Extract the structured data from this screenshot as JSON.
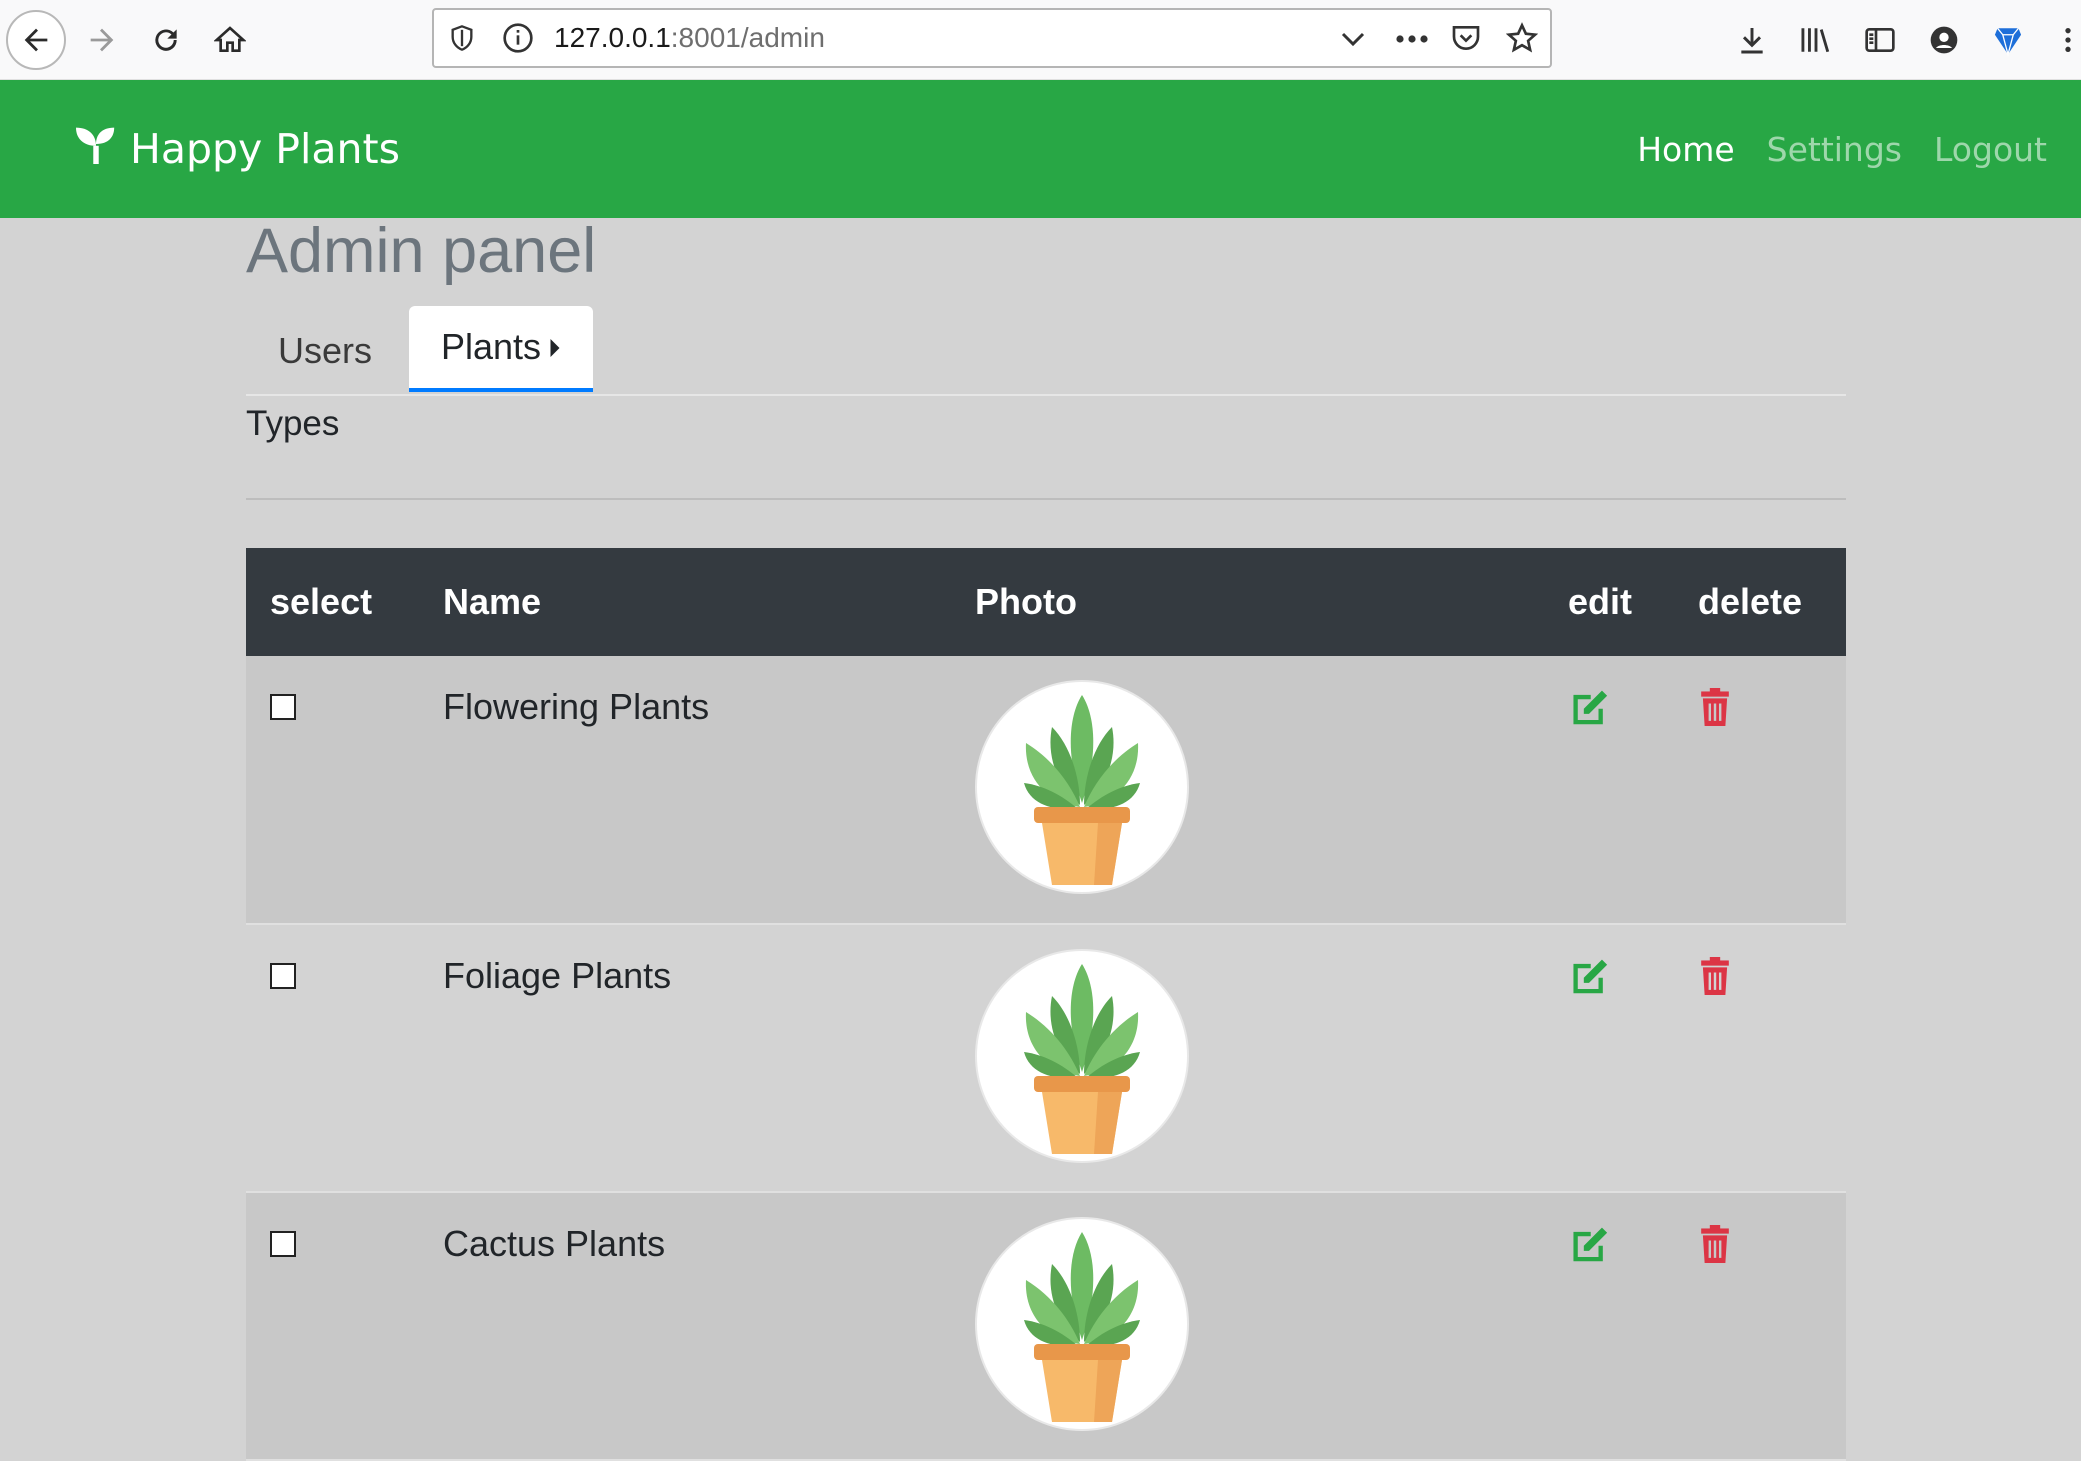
{
  "browser": {
    "url_host": "127.0.0.1",
    "url_rest": ":8001/admin"
  },
  "navbar": {
    "brand": "Happy Plants",
    "links": [
      {
        "label": "Home",
        "active": true
      },
      {
        "label": "Settings",
        "active": false
      },
      {
        "label": "Logout",
        "active": false
      }
    ]
  },
  "page": {
    "title": "Admin panel",
    "tabs": [
      {
        "label": "Users"
      },
      {
        "label": "Plants"
      }
    ],
    "subtab": "Types"
  },
  "table": {
    "headers": {
      "select": "select",
      "name": "Name",
      "photo": "Photo",
      "edit": "edit",
      "delete": "delete"
    },
    "rows": [
      {
        "name": "Flowering Plants",
        "checked": false
      },
      {
        "name": "Foliage Plants",
        "checked": false
      },
      {
        "name": "Cactus Plants",
        "checked": false
      }
    ]
  },
  "colors": {
    "navbar": "#28a745",
    "table_header": "#343a40",
    "edit": "#28a745",
    "delete": "#dc3545"
  }
}
